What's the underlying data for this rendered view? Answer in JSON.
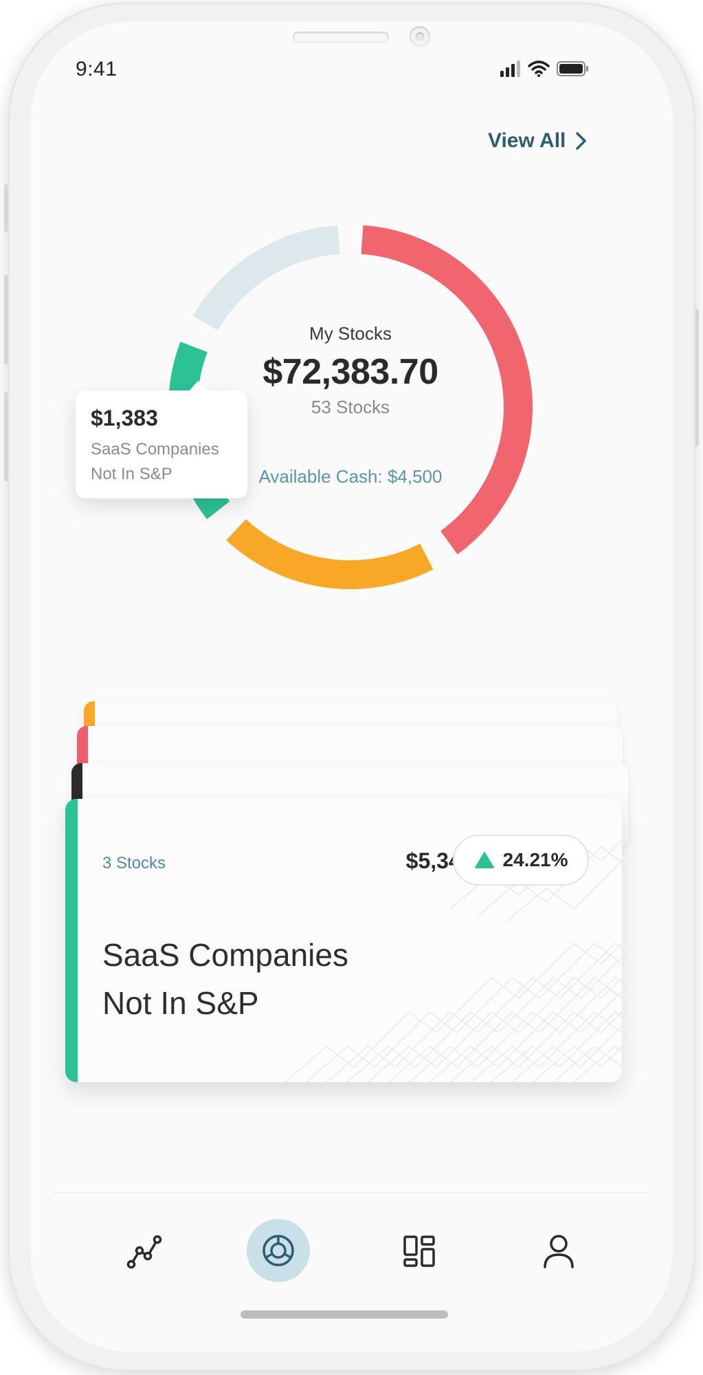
{
  "status_bar": {
    "time": "9:41"
  },
  "header": {
    "view_all_label": "View All"
  },
  "portfolio": {
    "label": "My Stocks",
    "total_value": "$72,383.70",
    "stock_count": "53 Stocks",
    "available_cash": "Available Cash: $4,500"
  },
  "tooltip": {
    "value": "$1,383",
    "line1": "SaaS Companies",
    "line2": "Not In S&P"
  },
  "donut_segments": [
    {
      "color": "#f0656e"
    },
    {
      "color": "#f9a727"
    },
    {
      "color": "#2dc295"
    },
    {
      "color": "#dce8ec"
    }
  ],
  "stack_cards": [
    {
      "accent_color": "#f9a727"
    },
    {
      "accent_color": "#ef5f6b"
    },
    {
      "accent_color": "#2b2b2b"
    }
  ],
  "main_card": {
    "stock_count": "3 Stocks",
    "amount": "$5,345.20",
    "change": "24.21%",
    "title_line1": "SaaS Companies",
    "title_line2": "Not In S&P",
    "accent_color": "#2dc295"
  },
  "tab_bar": {
    "items": [
      {
        "icon": "trend-line-icon"
      },
      {
        "icon": "donut-chart-icon",
        "active": true
      },
      {
        "icon": "dashboard-grid-icon"
      },
      {
        "icon": "user-profile-icon"
      }
    ]
  }
}
